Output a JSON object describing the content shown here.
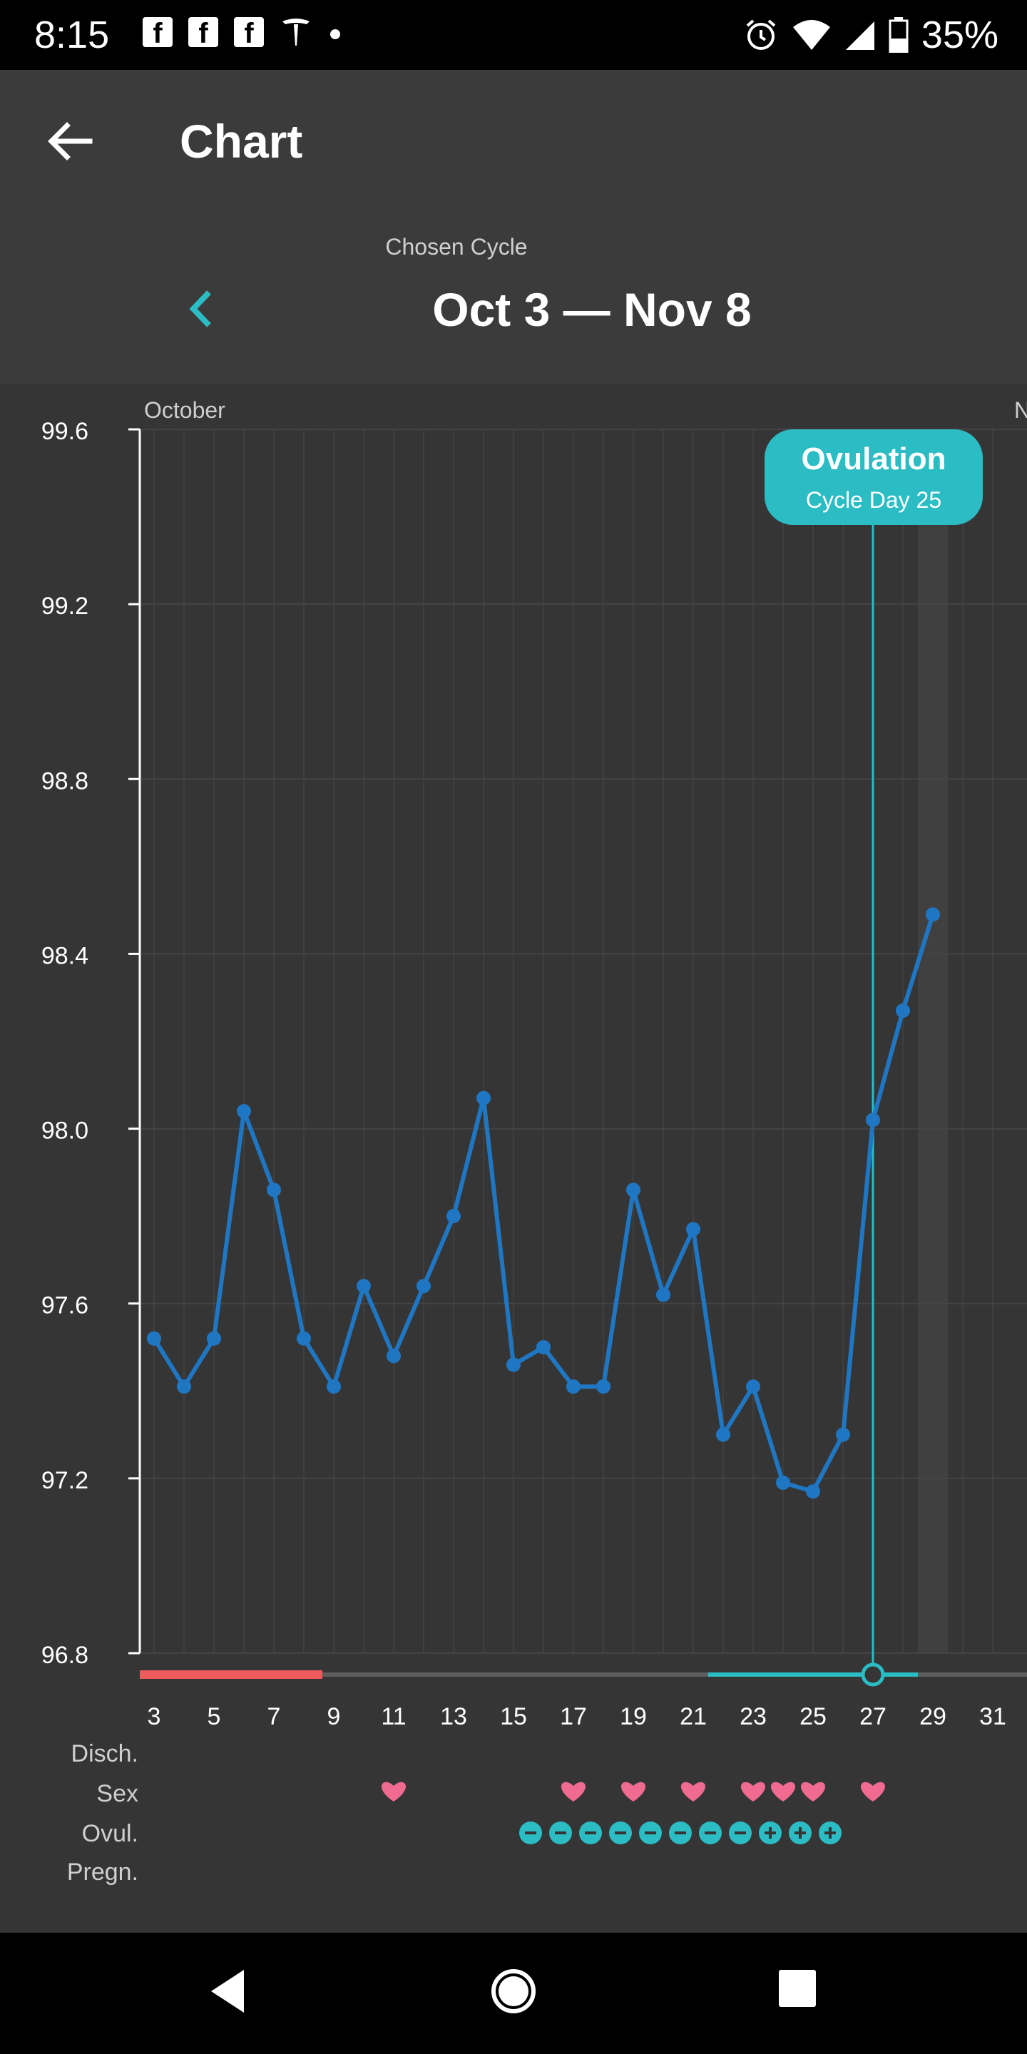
{
  "status_bar": {
    "time": "8:15",
    "battery": "35%",
    "icons_left": [
      "facebook-icon",
      "facebook-icon",
      "facebook-icon",
      "tesla-icon",
      "dot-icon"
    ],
    "icons_right": [
      "alarm-icon",
      "wifi-icon",
      "signal-icon",
      "battery-icon"
    ]
  },
  "app_bar": {
    "title": "Chart",
    "back_icon": "arrow-left-icon"
  },
  "cycle": {
    "label": "Chosen Cycle",
    "range": "Oct 3 — Nov 8",
    "prev_icon": "chevron-left-icon"
  },
  "colors": {
    "line": "#1f77c4",
    "teal": "#2bbcc4",
    "period": "#ef5a5a",
    "heart": "#f06b8f",
    "background": "#353535",
    "header": "#3b3b3b"
  },
  "chart_data": {
    "type": "line",
    "month_labels": [
      "October",
      "N"
    ],
    "x": [
      3,
      4,
      5,
      6,
      7,
      8,
      9,
      10,
      11,
      12,
      13,
      14,
      15,
      16,
      17,
      18,
      19,
      20,
      21,
      22,
      23,
      24,
      25,
      26,
      27,
      28,
      29
    ],
    "values": [
      97.52,
      97.41,
      97.52,
      98.04,
      97.86,
      97.52,
      97.41,
      97.64,
      97.48,
      97.64,
      97.8,
      98.07,
      97.46,
      97.5,
      97.41,
      97.41,
      97.86,
      97.62,
      97.77,
      97.3,
      97.41,
      97.19,
      97.17,
      97.3,
      98.02,
      98.27,
      98.49
    ],
    "ylim": [
      96.8,
      99.6
    ],
    "y_ticks": [
      "99.6",
      "99.2",
      "98.8",
      "98.4",
      "98.0",
      "97.6",
      "97.2",
      "96.8"
    ],
    "x_ticks": [
      "3",
      "5",
      "7",
      "9",
      "11",
      "13",
      "15",
      "17",
      "19",
      "21",
      "23",
      "25",
      "27",
      "29",
      "31"
    ],
    "grid": true,
    "ovulation": {
      "title": "Ovulation",
      "subtitle": "Cycle Day 25",
      "day": 27
    },
    "highlight_day": 29,
    "period_days": [
      3,
      8
    ],
    "fertile_window": [
      22,
      28
    ],
    "row_labels": [
      "Disch.",
      "Sex",
      "Ovul.",
      "Pregn."
    ],
    "sex_days": [
      11,
      17,
      19,
      21,
      23,
      24,
      25,
      27
    ],
    "ovul_tests": [
      {
        "day": 16,
        "result": "negative"
      },
      {
        "day": 17,
        "result": "negative"
      },
      {
        "day": 18,
        "result": "negative"
      },
      {
        "day": 19,
        "result": "negative"
      },
      {
        "day": 20,
        "result": "negative"
      },
      {
        "day": 21,
        "result": "negative"
      },
      {
        "day": 22,
        "result": "negative"
      },
      {
        "day": 23,
        "result": "negative"
      },
      {
        "day": 24,
        "result": "positive"
      },
      {
        "day": 25,
        "result": "positive"
      },
      {
        "day": 26,
        "result": "positive"
      }
    ]
  },
  "nav_bar": {
    "icons": [
      "back-triangle-icon",
      "home-circle-icon",
      "recents-square-icon"
    ]
  }
}
